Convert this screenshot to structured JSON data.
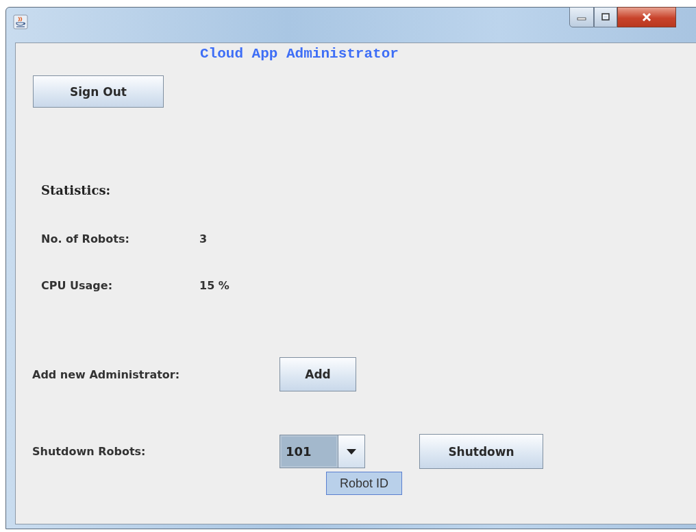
{
  "heading": "Cloud App Administrator",
  "sign_out": {
    "label": "Sign Out"
  },
  "statistics": {
    "title": "Statistics:",
    "rows": [
      {
        "label": "No. of Robots:",
        "value": "3"
      },
      {
        "label": "CPU Usage:",
        "value": "15 %"
      }
    ]
  },
  "add_admin": {
    "label": "Add new Administrator:",
    "button": "Add"
  },
  "shutdown": {
    "label": "Shutdown Robots:",
    "combo_value": "101",
    "tooltip": "Robot ID",
    "button": "Shutdown"
  }
}
